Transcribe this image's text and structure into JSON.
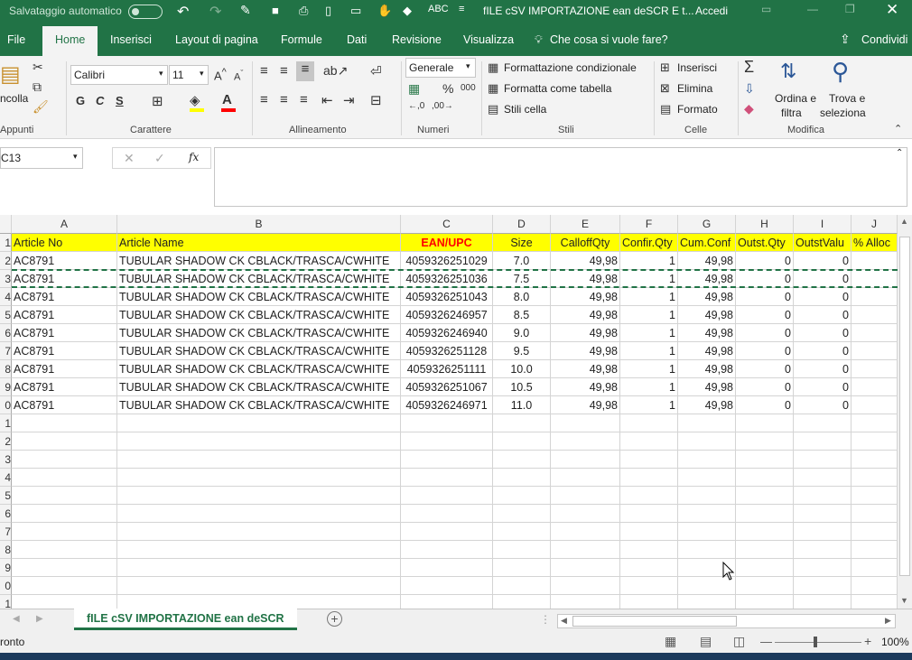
{
  "titlebar": {
    "autosave_label": "Salvataggio automatico",
    "file_title": "fILE cSV IMPORTAZIONE ean deSCR E t...",
    "signin": "Accedi"
  },
  "tabs": [
    {
      "label": "File",
      "active": false
    },
    {
      "label": "Home",
      "active": true
    },
    {
      "label": "Inserisci",
      "active": false
    },
    {
      "label": "Layout di pagina",
      "active": false
    },
    {
      "label": "Formule",
      "active": false
    },
    {
      "label": "Dati",
      "active": false
    },
    {
      "label": "Revisione",
      "active": false
    },
    {
      "label": "Visualizza",
      "active": false
    }
  ],
  "tellme": "Che cosa si vuole fare?",
  "share": "Condividi",
  "ribbon": {
    "clipboard": {
      "paste": "ncolla",
      "group": "Appunti"
    },
    "font": {
      "name": "Calibri",
      "size": "11",
      "group": "Carattere",
      "bold": "G",
      "italic": "C",
      "underline": "S"
    },
    "alignment": {
      "group": "Allineamento"
    },
    "number": {
      "format": "Generale",
      "group": "Numeri",
      "pct": "%",
      "thousands": "000"
    },
    "styles": {
      "conditional": "Formattazione condizionale",
      "table": "Formatta come tabella",
      "cell_styles": "Stili cella",
      "group": "Stili"
    },
    "cells": {
      "insert": "Inserisci",
      "delete": "Elimina",
      "format": "Formato",
      "group": "Celle"
    },
    "editing": {
      "sort": "Ordina e",
      "sort2": "filtra",
      "find": "Trova e",
      "find2": "seleziona",
      "group": "Modifica"
    }
  },
  "namebox": "C13",
  "formula": "",
  "columns": [
    "A",
    "B",
    "C",
    "D",
    "E",
    "F",
    "G",
    "H",
    "I",
    "J"
  ],
  "header_row": {
    "article_no": "Article No",
    "article_name": "Article Name",
    "ean": "EAN/UPC",
    "size": "Size",
    "calloff": "CalloffQty",
    "confir": "Confir.Qty",
    "cumconf": "Cum.Conf",
    "outstqty": "Outst.Qty",
    "outstval": "OutstValu",
    "alloc": "% Alloc"
  },
  "rows": [
    [
      "AC8791",
      "TUBULAR SHADOW CK  CBLACK/TRASCA/CWHITE",
      "4059326251029",
      "7.0",
      "49,98",
      "1",
      "49,98",
      "0",
      "0"
    ],
    [
      "AC8791",
      "TUBULAR SHADOW CK  CBLACK/TRASCA/CWHITE",
      "4059326251036",
      "7.5",
      "49,98",
      "1",
      "49,98",
      "0",
      "0"
    ],
    [
      "AC8791",
      "TUBULAR SHADOW CK  CBLACK/TRASCA/CWHITE",
      "4059326251043",
      "8.0",
      "49,98",
      "1",
      "49,98",
      "0",
      "0"
    ],
    [
      "AC8791",
      "TUBULAR SHADOW CK  CBLACK/TRASCA/CWHITE",
      "4059326246957",
      "8.5",
      "49,98",
      "1",
      "49,98",
      "0",
      "0"
    ],
    [
      "AC8791",
      "TUBULAR SHADOW CK  CBLACK/TRASCA/CWHITE",
      "4059326246940",
      "9.0",
      "49,98",
      "1",
      "49,98",
      "0",
      "0"
    ],
    [
      "AC8791",
      "TUBULAR SHADOW CK  CBLACK/TRASCA/CWHITE",
      "4059326251128",
      "9.5",
      "49,98",
      "1",
      "49,98",
      "0",
      "0"
    ],
    [
      "AC8791",
      "TUBULAR SHADOW CK  CBLACK/TRASCA/CWHITE",
      "4059326251111",
      "10.0",
      "49,98",
      "1",
      "49,98",
      "0",
      "0"
    ],
    [
      "AC8791",
      "TUBULAR SHADOW CK  CBLACK/TRASCA/CWHITE",
      "4059326251067",
      "10.5",
      "49,98",
      "1",
      "49,98",
      "0",
      "0"
    ],
    [
      "AC8791",
      "TUBULAR SHADOW CK  CBLACK/TRASCA/CWHITE",
      "4059326246971",
      "11.0",
      "49,98",
      "1",
      "49,98",
      "0",
      "0"
    ]
  ],
  "row_numbers": [
    "1",
    "2",
    "3",
    "4",
    "5",
    "6",
    "7",
    "8",
    "9",
    "0",
    "1",
    "2",
    "3",
    "4",
    "5",
    "6",
    "7",
    "8",
    "9",
    "0",
    "1"
  ],
  "sheet_tab": "fILE cSV IMPORTAZIONE ean deSCR",
  "status": {
    "ready": "ronto",
    "zoom": "100%"
  },
  "colors": {
    "accent": "#217346",
    "header_fill": "#ffff00",
    "ean_header": "#ff0000"
  }
}
